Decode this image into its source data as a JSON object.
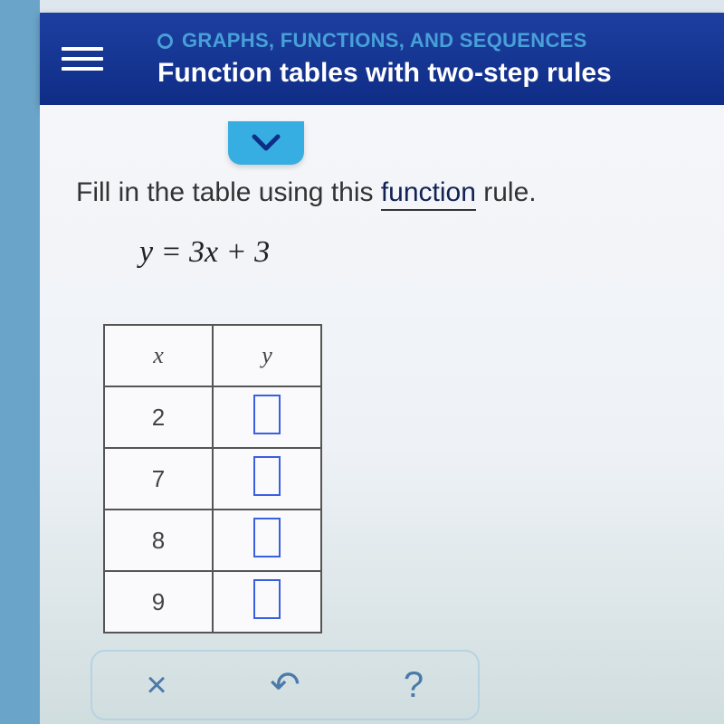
{
  "header": {
    "breadcrumb": "GRAPHS, FUNCTIONS, AND SEQUENCES",
    "title": "Function tables with two-step rules"
  },
  "problem": {
    "instruction_pre": "Fill in the table using this ",
    "instruction_link": "function",
    "instruction_post": " rule.",
    "equation": "y = 3x + 3"
  },
  "table": {
    "col_x": "x",
    "col_y": "y",
    "rows": [
      {
        "x": "2",
        "y": ""
      },
      {
        "x": "7",
        "y": ""
      },
      {
        "x": "8",
        "y": ""
      },
      {
        "x": "9",
        "y": ""
      }
    ]
  },
  "toolbar": {
    "clear": "×",
    "undo": "↶",
    "help": "?"
  }
}
